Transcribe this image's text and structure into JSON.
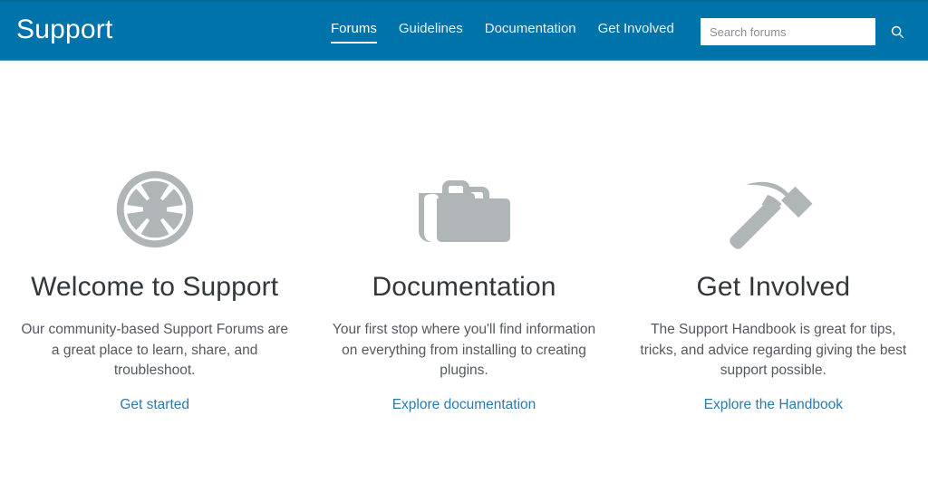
{
  "theme": {
    "header_bg": "#0073aa",
    "header_top_border": "#006799",
    "header_bottom_border": "#3c97c4",
    "icon_gray": "#b0b5b8",
    "heading_color": "#32373c",
    "body_text_color": "#55595e",
    "link_color": "#2a7ab0"
  },
  "header": {
    "site_title": "Support",
    "nav": [
      {
        "label": "Forums",
        "active": true
      },
      {
        "label": "Guidelines",
        "active": false
      },
      {
        "label": "Documentation",
        "active": false
      },
      {
        "label": "Get Involved",
        "active": false
      }
    ],
    "search": {
      "placeholder": "Search forums",
      "value": "",
      "submit_icon": "search-icon"
    }
  },
  "main": {
    "columns": [
      {
        "icon": "buoy-icon",
        "title": "Welcome to Support",
        "text": "Our community-based Support Forums are a great place to learn, share, and troubleshoot.",
        "link_label": "Get started"
      },
      {
        "icon": "portfolio-briefcase-icon",
        "title": "Documentation",
        "text": "Your first stop where you'll find information on everything from installing to creating plugins.",
        "link_label": "Explore documentation"
      },
      {
        "icon": "hammer-icon",
        "title": "Get Involved",
        "text": "The Support Handbook is great for tips, tricks, and advice regarding giving the best support possible.",
        "link_label": "Explore the Handbook"
      }
    ]
  }
}
